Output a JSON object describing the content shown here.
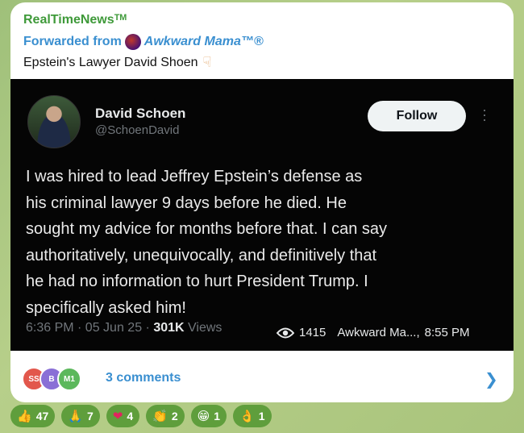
{
  "message": {
    "channel": "RealTimeNewsᵀᴹ",
    "forwarded_prefix": "Forwarded from",
    "forwarded_from": "Awkward Mama™®",
    "caption": "Epstein's Lawyer David Shoen"
  },
  "tweet": {
    "author_name": "David Schoen",
    "handle": "@SchoenDavid",
    "follow_label": "Follow",
    "lines": [
      "I was hired to lead Jeffrey Epstein’s defense as",
      "his criminal lawyer 9 days before he died.  He",
      "sought my advice for months before that.  I can say",
      "authoritatively, unequivocally, and definitively that",
      "he had no information to hurt President Trump.  I",
      "specifically asked him!"
    ],
    "time": "6:36 PM · 05 Jun 25 · ",
    "views_count": "301K",
    "views_label": " Views"
  },
  "post_meta": {
    "views": "1415",
    "author": "Awkward Ma...,",
    "time": "8:55 PM"
  },
  "comments": {
    "avatars": [
      {
        "initials": "SS",
        "color": "#e2574c"
      },
      {
        "initials": "B",
        "color": "#8a6fd6"
      },
      {
        "initials": "M1",
        "color": "#5cb85c"
      }
    ],
    "label": "3 comments"
  },
  "reactions": [
    {
      "emoji": "👍",
      "count": "47"
    },
    {
      "emoji": "🙏",
      "count": "7"
    },
    {
      "emoji": "❤",
      "count": "4"
    },
    {
      "emoji": "👏",
      "count": "2"
    },
    {
      "emoji": "😁",
      "count": "1"
    },
    {
      "emoji": "👌",
      "count": "1"
    }
  ]
}
